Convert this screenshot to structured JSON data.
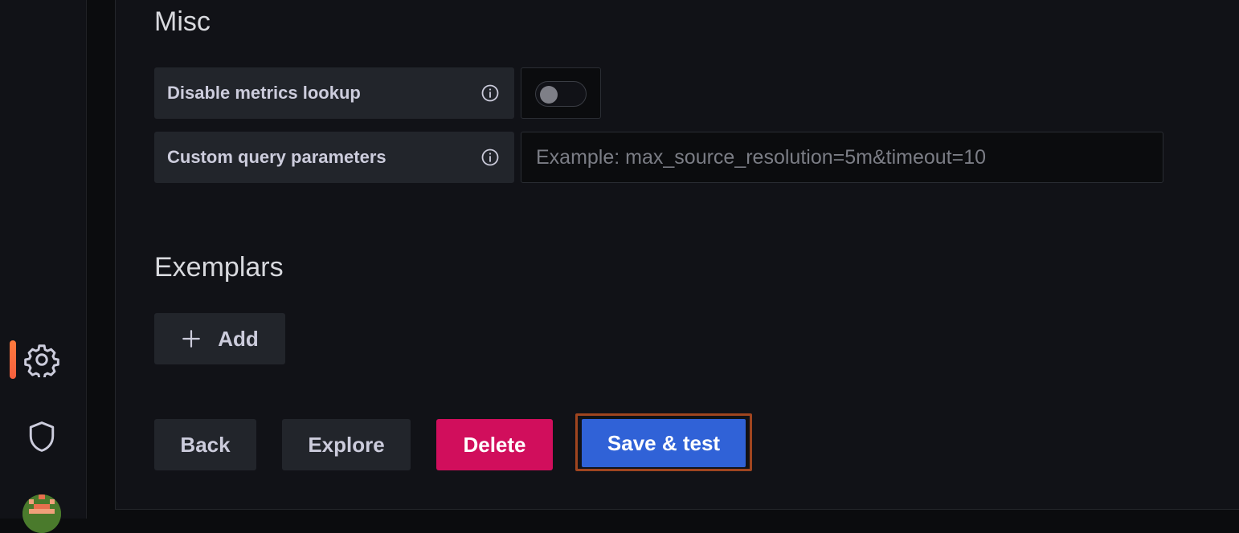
{
  "misc": {
    "title": "Misc",
    "disable_metrics_lookup": {
      "label": "Disable metrics lookup",
      "enabled": false
    },
    "custom_query_parameters": {
      "label": "Custom query parameters",
      "value": "",
      "placeholder": "Example: max_source_resolution=5m&timeout=10"
    }
  },
  "exemplars": {
    "title": "Exemplars",
    "add_label": "Add"
  },
  "actions": {
    "back_label": "Back",
    "explore_label": "Explore",
    "delete_label": "Delete",
    "save_label": "Save & test"
  },
  "sidebar": {
    "items": [
      {
        "icon": "gear-icon",
        "active": true
      },
      {
        "icon": "shield-icon",
        "active": false
      },
      {
        "icon": "avatar",
        "active": false
      }
    ]
  },
  "colors": {
    "accent_active": "#ff7a3d",
    "primary": "#3062d7",
    "destructive": "#d10e5c",
    "focus_outline": "#a0451f"
  }
}
